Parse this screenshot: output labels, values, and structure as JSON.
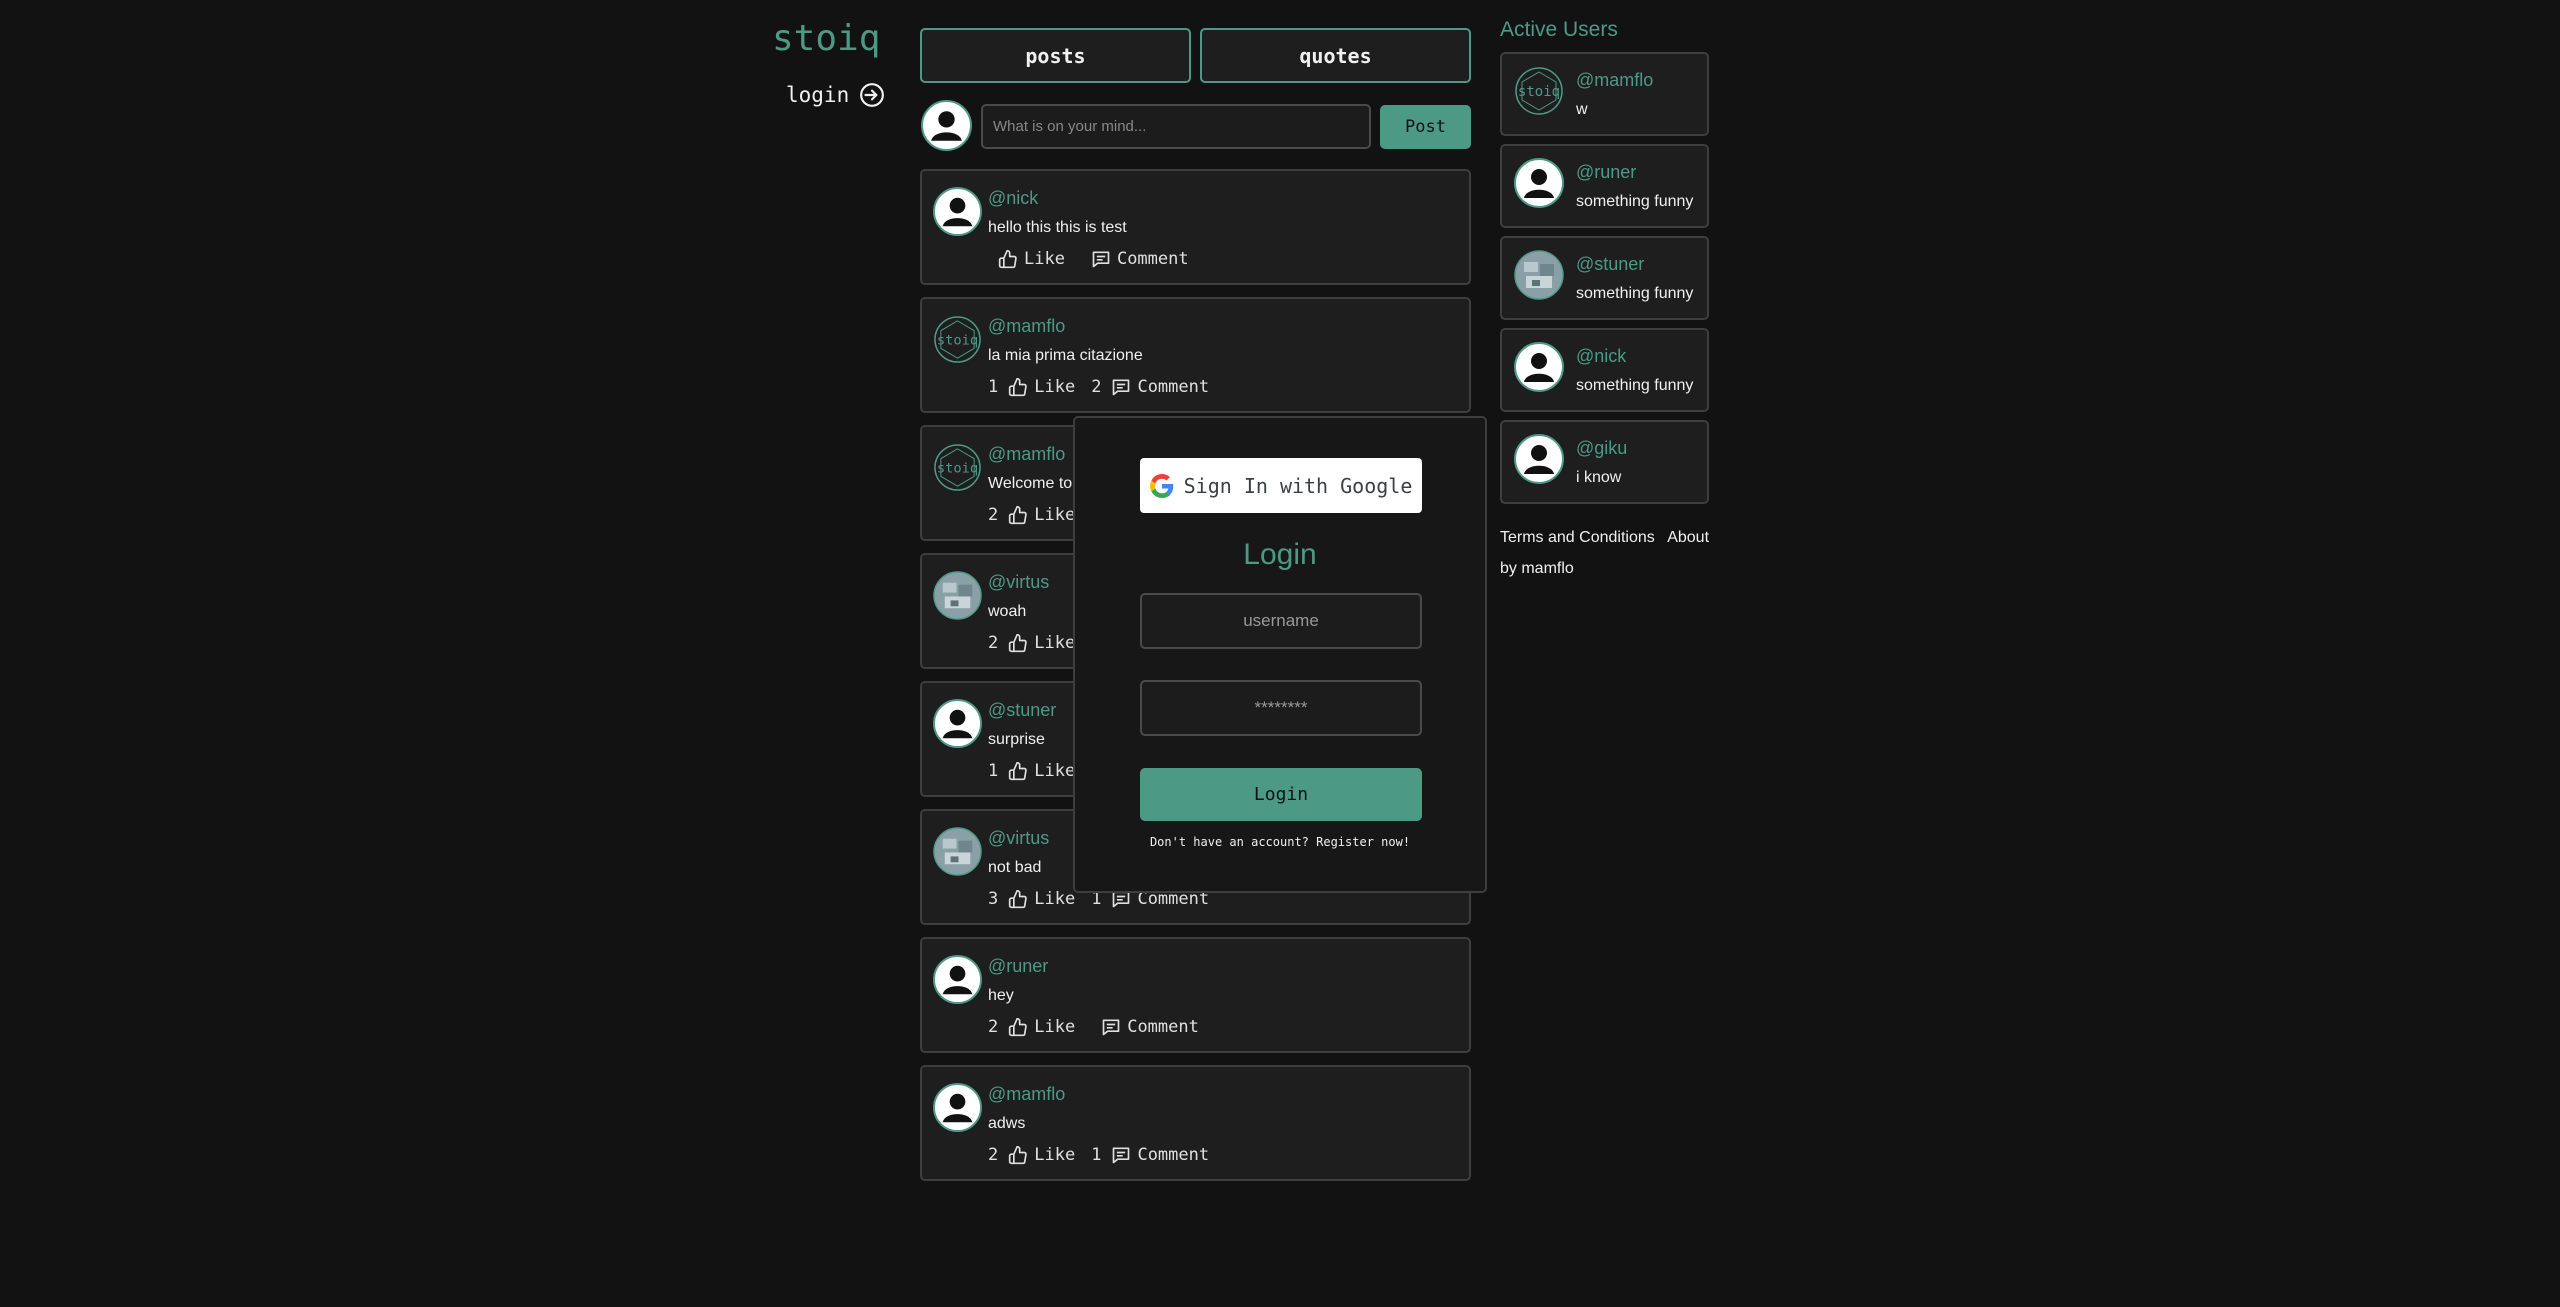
{
  "nav": {
    "brand": "stoiq",
    "login_label": "login"
  },
  "tabs": [
    {
      "label": "posts"
    },
    {
      "label": "quotes"
    }
  ],
  "composer": {
    "placeholder": "What is on your mind...",
    "post_label": "Post"
  },
  "actions": {
    "like_label": "Like",
    "comment_label": "Comment"
  },
  "posts": [
    {
      "user": "@nick",
      "text": "hello this this is test",
      "likes": "",
      "comments": "",
      "avatar": "default-avatar-icon"
    },
    {
      "user": "@mamflo",
      "text": "la mia prima citazione",
      "likes": "1",
      "comments": "2",
      "avatar": "stoiq-logo-avatar"
    },
    {
      "user": "@mamflo",
      "text": "Welcome to stoiq",
      "likes": "2",
      "comments": "",
      "avatar": "stoiq-logo-avatar"
    },
    {
      "user": "@virtus",
      "text": "woah",
      "likes": "2",
      "comments": "",
      "avatar": "photo-avatar"
    },
    {
      "user": "@stuner",
      "text": "surprise",
      "likes": "1",
      "comments": "",
      "avatar": "default-avatar-icon"
    },
    {
      "user": "@virtus",
      "text": "not bad",
      "likes": "3",
      "comments": "1",
      "avatar": "photo-avatar"
    },
    {
      "user": "@runer",
      "text": "hey",
      "likes": "2",
      "comments": "",
      "avatar": "default-avatar-icon"
    },
    {
      "user": "@mamflo",
      "text": "adws",
      "likes": "2",
      "comments": "1",
      "avatar": "default-avatar-icon"
    }
  ],
  "active_users": {
    "title": "Active Users",
    "items": [
      {
        "user": "@mamflo",
        "quote": "w",
        "avatar": "stoiq-logo-avatar"
      },
      {
        "user": "@runer",
        "quote": "something funny",
        "avatar": "default-avatar-icon"
      },
      {
        "user": "@stuner",
        "quote": "something funny",
        "avatar": "photo-avatar"
      },
      {
        "user": "@nick",
        "quote": "something funny",
        "avatar": "default-avatar-icon"
      },
      {
        "user": "@giku",
        "quote": "i know",
        "avatar": "default-avatar-icon"
      }
    ]
  },
  "footer": {
    "terms": "Terms and Conditions",
    "about": "About",
    "credit": "by mamflo"
  },
  "login_modal": {
    "google_label": "Sign In with Google",
    "title": "Login",
    "username_placeholder": "username",
    "password_placeholder": "********",
    "submit_label": "Login",
    "register_text": "Don't have an account? Register now!"
  },
  "colors": {
    "accent": "#4d9a84",
    "background": "#121212",
    "card": "#1e1e1e"
  }
}
